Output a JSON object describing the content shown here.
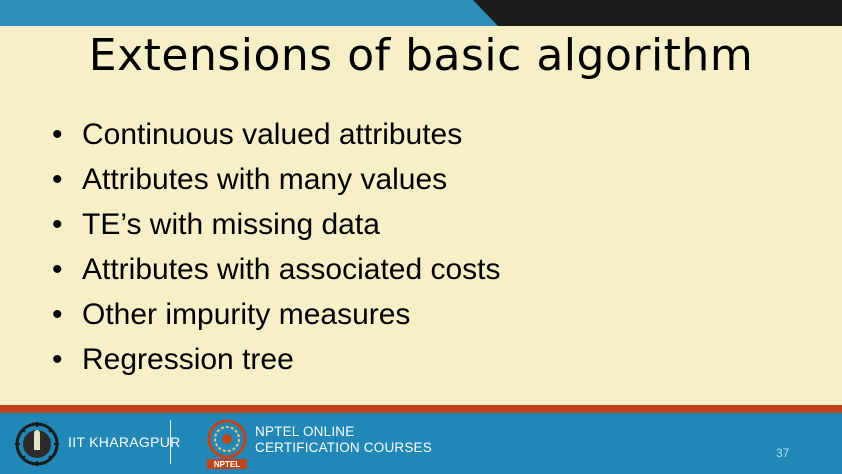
{
  "slide": {
    "title": "Extensions of basic algorithm",
    "bullets": [
      "Continuous valued attributes",
      "Attributes with many values",
      "TE’s with missing data",
      "Attributes with associated costs",
      "Other impurity measures",
      "Regression tree"
    ],
    "bullet_symbol": "•",
    "page_number": "37"
  },
  "footer": {
    "institute": "IIT KHARAGPUR",
    "program_line1": "NPTEL ONLINE",
    "program_line2": "CERTIFICATION COURSES",
    "nptel_logo_text": "NPTEL"
  },
  "colors": {
    "background": "#f7efc8",
    "top_band": "#2b8fba",
    "top_dark": "#1c1c1c",
    "footer": "#2087b6",
    "accent_stripe": "#c0431a"
  }
}
